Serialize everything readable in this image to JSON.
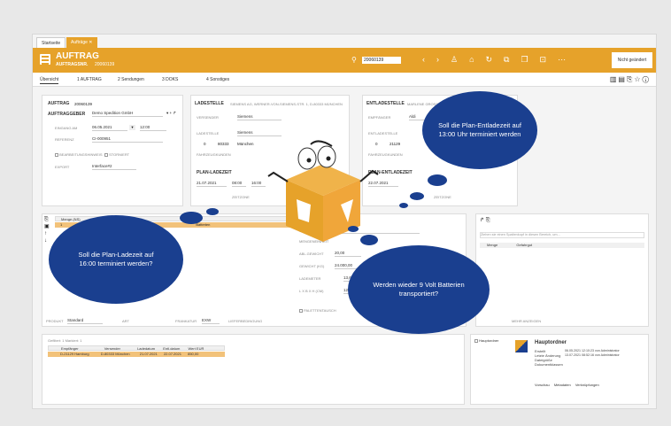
{
  "window_tabs": [
    "Startseite",
    "Aufträge"
  ],
  "header": {
    "title": "AUFTRAG",
    "subtitle_label": "AUFTRAGSNR.",
    "subtitle_value": "20060139",
    "search_value": "20060139",
    "changed_label": "Nicht geändert"
  },
  "subtabs": [
    "Übersicht",
    "1 AUFTRAG",
    "2 Sendungen",
    "3 DOKS",
    "4 Sonstiges"
  ],
  "auftrag": {
    "title": "AUFTRAG",
    "nr": "20060139",
    "auftraggeber_label": "AUFTRAGGEBER",
    "auftraggeber_value": "Demo Spedition GmbH",
    "eingang_label": "EINGANG AM",
    "eingang_date": "06.05.2021",
    "eingang_time": "12:00",
    "referenz_label": "REFERENZ",
    "referenz_value": "CI-000951",
    "check1": "BEARBEITUNGSHINWEIS",
    "check2": "STORNIERT",
    "export_label": "EXPORT",
    "export_value": "Interface#2"
  },
  "ladestelle": {
    "title": "LADESTELLE",
    "subtitle": "SIEMENS AG, WERNER-VON-SIEMENS-STR. 1, D-80333 MÜNCHEN",
    "versender_label": "VERSENDER",
    "versender_value": "Siemens",
    "ladestelle_label": "LADESTELLE",
    "ladestelle_value": "Siemens",
    "plz": "0",
    "ort": "80333",
    "ort2": "München",
    "fahrzeug_label": "FAHRZEUGKUNDEN",
    "plan_title": "PLAN-LADEZEIT",
    "plan_date": "21.07.2021",
    "plan_from": "08:00",
    "plan_to": "16:00",
    "zeitzone": "ZEITZONE"
  },
  "entladestelle": {
    "title": "ENTLADESTELLE",
    "subtitle": "MARLENE GROSSHANDLUNG, HAMBURG",
    "empfaenger_label": "EMPFÄNGER",
    "empfaenger_value": "Aldi",
    "entladestelle_label": "ENTLADESTELLE",
    "plz": "0",
    "ort": "21129",
    "fahrzeug_label": "FAHRZEUGKUNDEN",
    "plan_title": "PLAN-ENTLADEZEIT",
    "plan_date": "22.07.2021",
    "zeitzone": "ZEITZONE"
  },
  "positions": {
    "header_cols": [
      "Menge (NS)",
      "VE",
      "Ware"
    ],
    "row": {
      "menge": "1",
      "ware": "Batterien"
    },
    "tabs": [
      "WARE",
      "DETAILS",
      "ADR"
    ],
    "ware_label": "WARE",
    "ware_value": "Batterien",
    "fields": [
      {
        "label": "MENGENEINHEIT",
        "value": ""
      },
      {
        "label": "ABL.GEWICHT",
        "value": "20,00"
      },
      {
        "label": "GEWICHT (KG)",
        "value": "24.000,00"
      },
      {
        "label": "LADEMETER",
        "value": "13,60"
      },
      {
        "label": "L X B X H (CM)",
        "value": "120"
      }
    ],
    "right_cols": [
      "ANZAHL ST.",
      "MENGENEINHEIT",
      "VOLUMEN",
      "STAPELFAKTOR"
    ],
    "palettentausch": "PALETTENTAUSCH",
    "produkt_label": "PRODUKT",
    "produkt_value": "Standard",
    "art_label": "ART",
    "frankatur_label": "FRANKATUR",
    "frankatur_value": "EXW",
    "lieferbedingung_label": "LIEFERBEDINGUNG"
  },
  "sidepanel": {
    "search_placeholder": "Ziehen sie einen Spaltenkopf in diesen Bereich, um...",
    "cols": [
      "Menge",
      "Gefahrgut"
    ],
    "more": "MEHR ANZEIGEN"
  },
  "footer_grid": {
    "filter": "Gefiltert: 1 Markiert: 1",
    "cols": [
      "Empfänger",
      "Versender",
      "Ladedatum",
      "Entl.datum",
      "Wert EUR"
    ],
    "row": [
      "D-21129 Hamburg",
      "D-80333 München",
      "21.07.2021",
      "22.07.2021",
      "850,00"
    ]
  },
  "hauptordner": {
    "title": "Hauptordner",
    "checkbox": "Hauptordner",
    "lines": [
      "Erstellt",
      "Letzte Änderung",
      "Dateigröße",
      "Dokumentklassen"
    ],
    "values": [
      "06.05.2021 12:10:23 von Administrator",
      "13.07.2021 08:52:16 von Administrator",
      "",
      ""
    ],
    "tabs": [
      "Vorschau",
      "Metadaten",
      "Verknüpfungen"
    ]
  },
  "clouds": {
    "c1": "Soll die Plan-Entladezeit auf 13:00 Uhr terminiert werden",
    "c2": "Soll die Plan-Ladezeit auf 16:00 terminiert werden?",
    "c3": "Werden wieder 9 Volt Batterien transportiert?"
  },
  "colors": {
    "accent": "#e6a22a",
    "cloud": "#1a3f8f"
  }
}
